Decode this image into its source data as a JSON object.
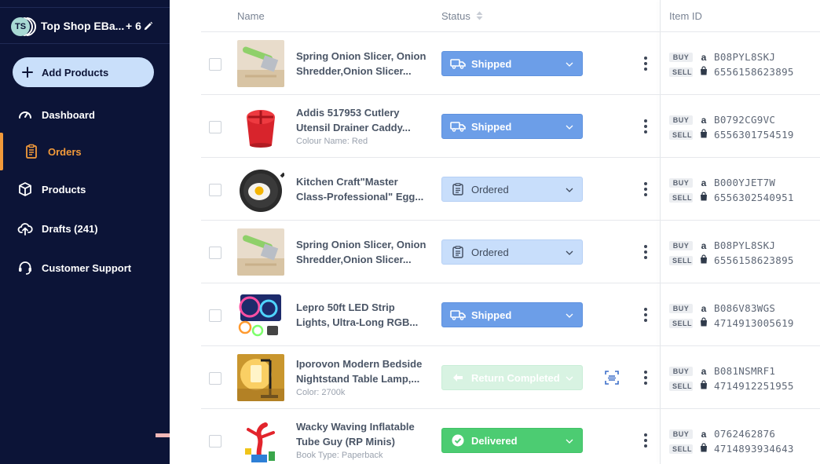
{
  "sidebar": {
    "avatar_initials": "TS",
    "store_name": "Top Shop EBa...",
    "store_count": "+ 6",
    "add_products_label": "Add Products",
    "nav": [
      {
        "label": "Dashboard",
        "icon": "gauge-icon",
        "active": false
      },
      {
        "label": "Orders",
        "icon": "clipboard-icon",
        "active": true
      },
      {
        "label": "Products",
        "icon": "box-icon",
        "active": false
      },
      {
        "label": "Drafts (241)",
        "icon": "cloud-upload-icon",
        "active": false
      },
      {
        "label": "Customer Support",
        "icon": "headset-icon",
        "active": false
      }
    ],
    "accent_color": "#f29a3a",
    "bg_color": "#0c1437"
  },
  "table": {
    "headers": {
      "name": "Name",
      "status": "Status",
      "item_id": "Item ID"
    },
    "buy_tag": "BUY",
    "sell_tag": "SELL",
    "buy_marketplace_glyph": "a",
    "rows": [
      {
        "name_l1": "Spring Onion Slicer, Onion",
        "name_l2": "Shredder,Onion Slicer...",
        "attr": "",
        "status": "Shipped",
        "status_type": "shipped",
        "buy_id": "B08PYL8SKJ",
        "sell_id": "6556158623895",
        "thumb": "onion-slicer-image"
      },
      {
        "name_l1": "Addis 517953 Cutlery",
        "name_l2": "Utensil Drainer Caddy...",
        "attr": "Colour Name: Red",
        "status": "Shipped",
        "status_type": "shipped",
        "buy_id": "B0792CG9VC",
        "sell_id": "6556301754519",
        "thumb": "cutlery-caddy-image"
      },
      {
        "name_l1": "Kitchen Craft\"Master",
        "name_l2": "Class-Professional\" Egg...",
        "attr": "",
        "status": "Ordered",
        "status_type": "ordered",
        "buy_id": "B000YJET7W",
        "sell_id": "6556302540951",
        "thumb": "egg-pan-image"
      },
      {
        "name_l1": "Spring Onion Slicer, Onion",
        "name_l2": "Shredder,Onion Slicer...",
        "attr": "",
        "status": "Ordered",
        "status_type": "ordered",
        "buy_id": "B08PYL8SKJ",
        "sell_id": "6556158623895",
        "thumb": "onion-slicer-image"
      },
      {
        "name_l1": "Lepro 50ft LED Strip",
        "name_l2": "Lights, Ultra-Long RGB...",
        "attr": "",
        "status": "Shipped",
        "status_type": "shipped",
        "buy_id": "B086V83WGS",
        "sell_id": "4714913005619",
        "thumb": "led-strip-image"
      },
      {
        "name_l1": "Iporovon Modern Bedside",
        "name_l2": "Nightstand Table Lamp,...",
        "attr": "Color: 2700k",
        "status": "Return Completed",
        "status_type": "return",
        "buy_id": "B081NSMRF1",
        "sell_id": "4714912251955",
        "thumb": "table-lamp-image"
      },
      {
        "name_l1": "Wacky Waving Inflatable",
        "name_l2": "Tube Guy (RP Minis)",
        "attr": "Book Type: Paperback",
        "status": "Delivered",
        "status_type": "delivered",
        "buy_id": "0762462876",
        "sell_id": "4714893934643",
        "thumb": "tube-guy-image"
      }
    ]
  }
}
